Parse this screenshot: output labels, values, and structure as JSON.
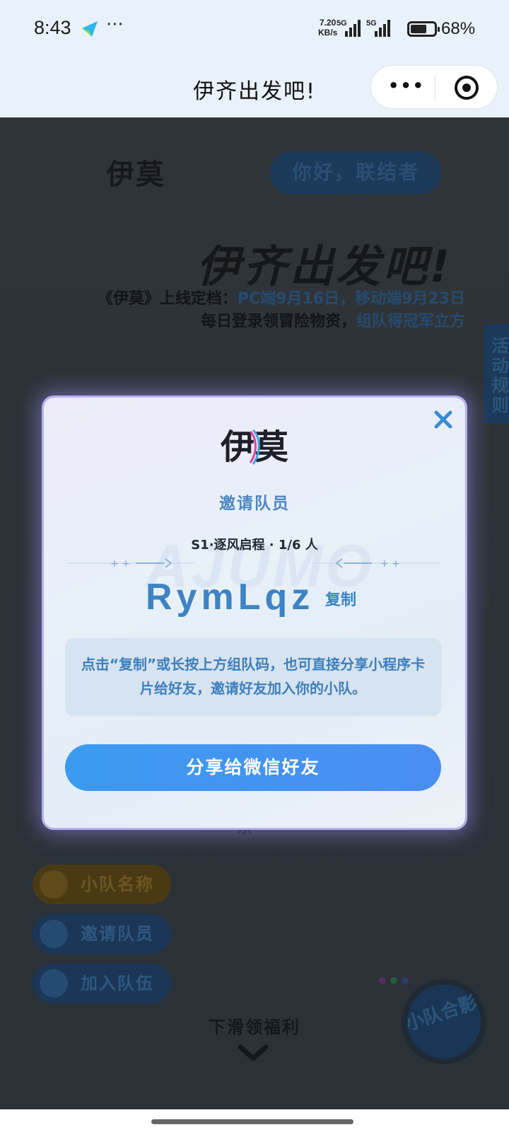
{
  "status_bar": {
    "time": "8:43",
    "dots": "···",
    "net_speed_value": "7.20",
    "net_speed_unit": "KB/s",
    "signal1_label": "5G",
    "signal2_label": "5G",
    "battery_percent": "68%",
    "battery_level": 0.68
  },
  "nav": {
    "title": "伊齐出发吧!",
    "more_label": "•••"
  },
  "background": {
    "logo": "伊莫",
    "greeting": "你好，联结者",
    "headline": "伊齐出发吧!",
    "sub1_prefix": "《伊莫》上线定档：",
    "sub1_highlight": "PC端9月16日，移动端9月23日",
    "sub2_prefix": "每日登录领冒险物资，",
    "sub2_highlight": "组队得冠军立方",
    "rules_tab": "活动规则",
    "partial_text": "乐",
    "buttons": {
      "team_name": "小队名称",
      "invite": "邀请队员",
      "join": "加入队伍"
    },
    "scroll_hint": "下滑领福利",
    "photo_button": "小队合影"
  },
  "modal": {
    "logo": "伊莫",
    "title": "邀请队员",
    "season_info": "S1·逐风启程 · 1/6 人",
    "team_code": "RymLqz",
    "copy_label": "复制",
    "tip_text": "点击“复制”或长按上方组队码，也可直接分享小程序卡片给好友，邀请好友加入你的小队。",
    "share_label": "分享给微信好友",
    "watermark": "AJUMO"
  },
  "colors": {
    "accent": "#3d83c5",
    "share_button": "#4a8ef3",
    "modal_glow": "#b7b1ee"
  }
}
